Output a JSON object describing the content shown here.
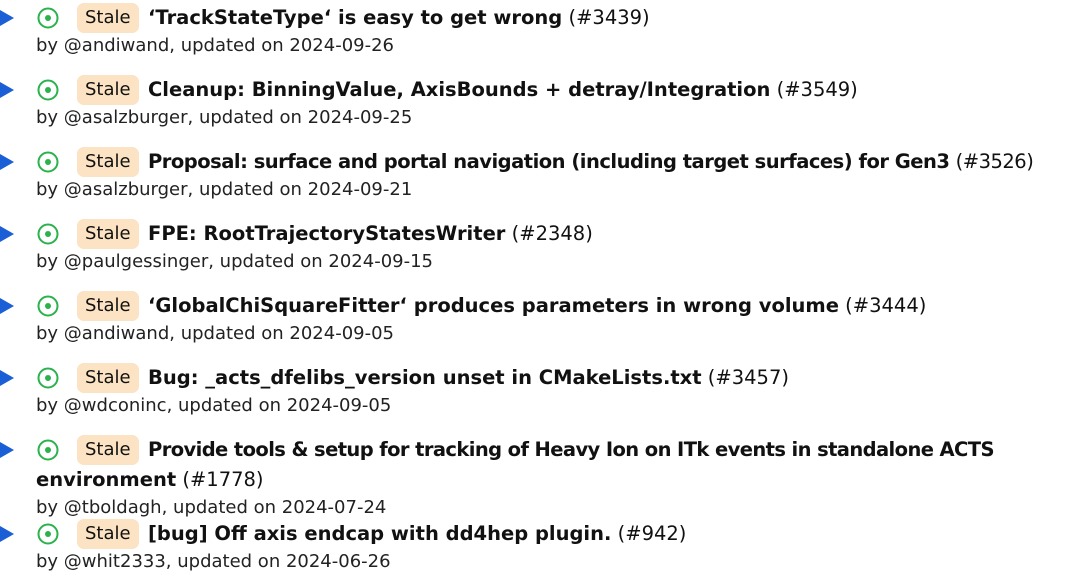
{
  "accent_color": "#1a5fd6",
  "status_color": "#2ab24e",
  "badge_color": "#fbe3c3",
  "items": [
    {
      "badge": "Stale",
      "title": "‘TrackStateType‘ is easy to get wrong",
      "number": "(#3439)",
      "meta": "by @andiwand, updated on 2024-09-26"
    },
    {
      "badge": "Stale",
      "title": "Cleanup: BinningValue, AxisBounds + detray/Integration",
      "number": "(#3549)",
      "meta": "by @asalzburger, updated on 2024-09-25"
    },
    {
      "badge": "Stale",
      "title": "Proposal: surface and portal navigation (including target surfaces) for Gen3",
      "number": " (#3526)",
      "meta": "by @asalzburger, updated on 2024-09-21"
    },
    {
      "badge": "Stale",
      "title": "FPE: RootTrajectoryStatesWriter",
      "number": "(#2348)",
      "meta": "by @paulgessinger, updated on 2024-09-15"
    },
    {
      "badge": "Stale",
      "title": "‘GlobalChiSquareFitter‘ produces parameters in wrong volume",
      "number": "(#3444)",
      "meta": "by @andiwand, updated on 2024-09-05"
    },
    {
      "badge": "Stale",
      "title": "Bug: _acts_dfelibs_version unset in CMakeLists.txt",
      "number": "(#3457)",
      "meta": "by @wdconinc, updated on 2024-09-05"
    },
    {
      "badge": "Stale",
      "title": "Provide tools & setup for tracking of Heavy Ion on ITk events in standalone ACTS",
      "title_cont": "environment",
      "number": "(#1778)",
      "meta": "by @tboldagh, updated on 2024-07-24"
    },
    {
      "badge": "Stale",
      "title": "[bug] Off axis endcap with dd4hep plugin.",
      "number": "(#942)",
      "meta": "by @whit2333, updated on 2024-06-26"
    }
  ]
}
